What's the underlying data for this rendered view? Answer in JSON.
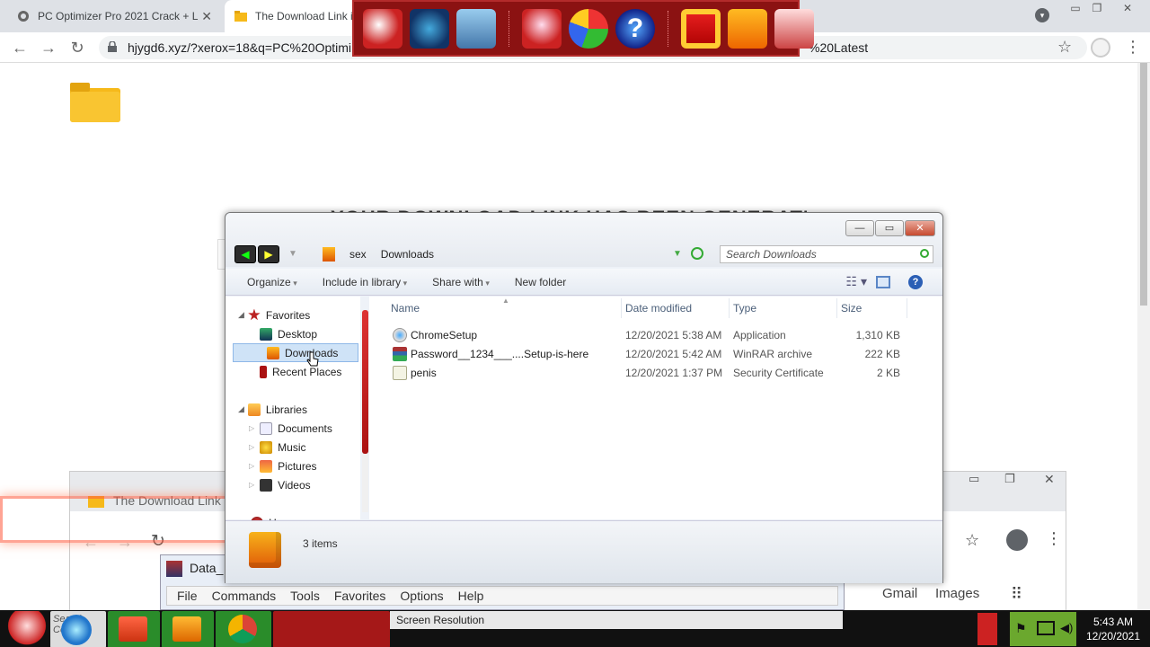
{
  "browser": {
    "tabs": [
      {
        "label": "PC Optimizer Pro 2021 Crack + L"
      },
      {
        "label": "The Download Link i"
      }
    ],
    "url": "hjygd6.xyz/?xerox=18&q=PC%20Optimi",
    "url_tail": "%20Latest"
  },
  "page": {
    "heading": "YOUR DOWNLOAD LINK HAS BEEN GENERATED"
  },
  "explorer": {
    "breadcrumb": [
      "sex",
      "Downloads"
    ],
    "search_placeholder": "Search Downloads",
    "commands": {
      "organize": "Organize",
      "include": "Include in library",
      "share": "Share with",
      "new_folder": "New folder"
    },
    "nav": {
      "favorites": "Favorites",
      "desktop": "Desktop",
      "downloads": "Downloads",
      "recent": "Recent Places",
      "libraries": "Libraries",
      "documents": "Documents",
      "music": "Music",
      "pictures": "Pictures",
      "videos": "Videos",
      "homegroup": "Homegroup"
    },
    "columns": {
      "name": "Name",
      "date": "Date modified",
      "type": "Type",
      "size": "Size"
    },
    "files": [
      {
        "name": "ChromeSetup",
        "date": "12/20/2021 5:38 AM",
        "type": "Application",
        "size": "1,310 KB"
      },
      {
        "name": "Password__1234___....Setup-is-here",
        "date": "12/20/2021 5:42 AM",
        "type": "WinRAR archive",
        "size": "222 KB"
      },
      {
        "name": "penis",
        "date": "12/20/2021 1:37 PM",
        "type": "Security Certificate",
        "size": "2 KB"
      }
    ],
    "status": "3 items"
  },
  "background_window": {
    "tab_label": "The Download Link",
    "gmail": "Gmail",
    "images": "Images"
  },
  "winrar": {
    "title": "Data_",
    "menu": [
      "File",
      "Commands",
      "Tools",
      "Favorites",
      "Options",
      "Help"
    ]
  },
  "taskbar": {
    "search_label": "Search Com",
    "active_label": "Screen Resolution",
    "time": "5:43 AM",
    "date": "12/20/2021"
  },
  "colors": {
    "ad_bar": "#8b1212",
    "selection": "#cfe3f7",
    "scroll_thumb": "#cc2222"
  }
}
